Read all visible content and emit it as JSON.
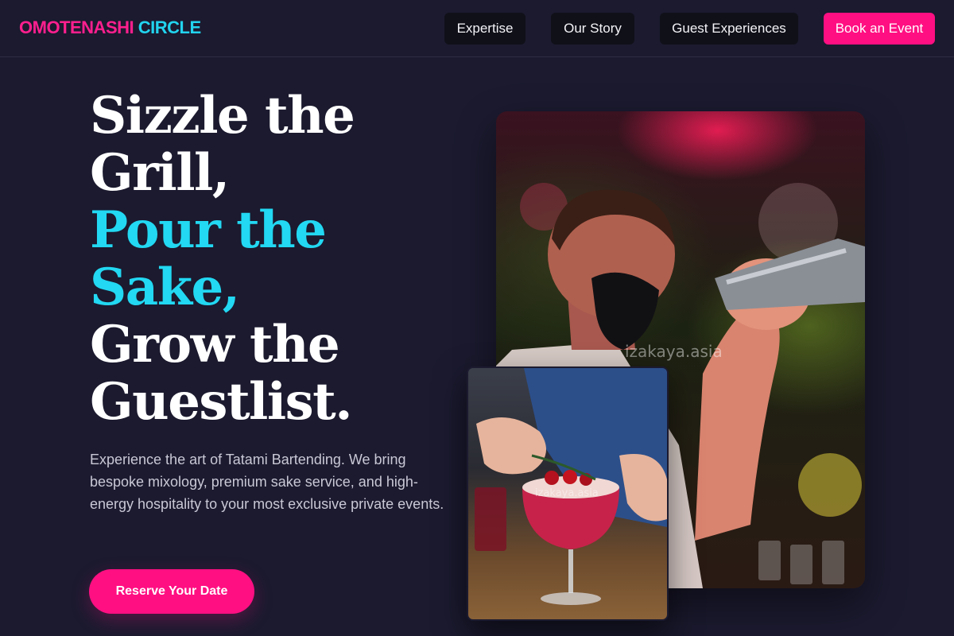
{
  "brand": {
    "part1": "OMOTENASHI",
    "part2": "CIRCLE"
  },
  "nav": {
    "expertise": "Expertise",
    "story": "Our Story",
    "guest": "Guest Experiences",
    "book": "Book an Event"
  },
  "hero": {
    "line1": "Sizzle the",
    "line2": "Grill,",
    "line3": "Pour the",
    "line4": "Sake,",
    "line5": "Grow the",
    "line6": "Guestlist.",
    "description": "Experience the art of Tatami Bartending. We bring bespoke mixology, premium sake service, and high-energy hospitality to your most exclusive private events.",
    "cta": "Reserve Your Date"
  },
  "images": {
    "main_watermark": "izakaya.asia",
    "small_watermark": "izakaya.asia"
  },
  "colors": {
    "background": "#1b1a2f",
    "accent_pink": "#ff0f82",
    "accent_cyan": "#22d8f2",
    "nav_button_bg": "#101019"
  }
}
